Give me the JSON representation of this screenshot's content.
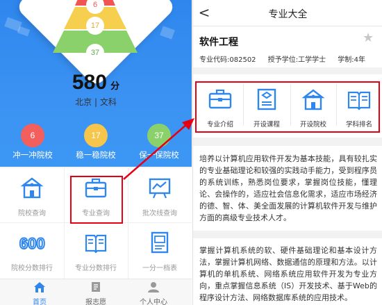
{
  "left": {
    "pyramid": {
      "badges": [
        "6",
        "17",
        "37"
      ],
      "colors": [
        "#f25454",
        "#f5cf4d",
        "#8bd16b"
      ]
    },
    "score": {
      "value": "580",
      "unit": "分",
      "subtitle": "北京 | 文科"
    },
    "tiers": [
      {
        "count": "6",
        "label": "冲一冲院校",
        "color": "#f25f5c"
      },
      {
        "count": "17",
        "label": "稳一稳院校",
        "color": "#f5c54c"
      },
      {
        "count": "37",
        "label": "保一保院校",
        "color": "#8bd16b"
      }
    ],
    "grid": [
      {
        "label": "院校查询",
        "icon": "school-icon"
      },
      {
        "label": "专业查询",
        "icon": "briefcase-icon"
      },
      {
        "label": "批次线查询",
        "icon": "chart-board-icon"
      },
      {
        "label": "院校分数排行",
        "icon": "600-icon"
      },
      {
        "label": "专业分数排行",
        "icon": "book-icon"
      },
      {
        "label": "一分一档表",
        "icon": "document-icon"
      }
    ],
    "tabs": [
      {
        "label": "首页",
        "icon": "home-icon",
        "active": true
      },
      {
        "label": "报志愿",
        "icon": "form-icon",
        "active": false
      },
      {
        "label": "个人中心",
        "icon": "user-icon",
        "active": false
      }
    ],
    "accent": "#2f87ee"
  },
  "right": {
    "nav": {
      "back": "<",
      "title": "专业大全"
    },
    "major": {
      "name": "软件工程",
      "code_label": "专业代码:082502",
      "degree_label": "授予学位:工学学士",
      "duration_label": "学制:4年"
    },
    "cards": [
      {
        "label": "专业介绍",
        "icon": "briefcase-icon"
      },
      {
        "label": "开设课程",
        "icon": "course-icon"
      },
      {
        "label": "开设院校",
        "icon": "school-icon"
      },
      {
        "label": "学科排名",
        "icon": "book-icon"
      }
    ],
    "para1": "培养以计算机应用软件开发为基本技能，具有较扎实的专业基础理论和较强的实践动手能力，受到程序员的系统训练，熟悉岗位要求，掌握岗位技能，懂理论、会操作的，适应社会信息化需求，适应市场经济的德、智、体、美全面发展的计算机软件开发与维护方面的高级专业技术人才。",
    "para2": "掌握计算机系统的软、硬件基础理论和基本设计方法，掌握计算机网络、数据通信的原理和方法。以计算机的单机系统、网络系统应用软件开发为专业方向，重点掌握信息系统（IS）开发技术、基于Web的程序设计方法、网络数据库系统的应用技术。"
  },
  "highlight_color": "#e60012"
}
